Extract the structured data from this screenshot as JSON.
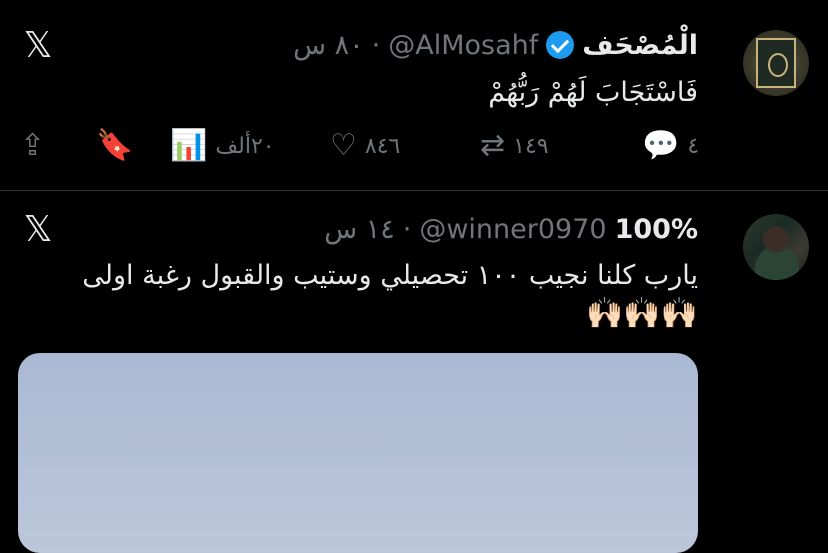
{
  "tweets": [
    {
      "display_name": "الْمُصْحَف",
      "handle": "@AlMosahf",
      "time": "٨٠ س",
      "separator": "·",
      "verified": true,
      "text": "فَاسْتَجَابَ لَهُمْ رَبُّهُمْ",
      "actions": {
        "reply": "٤",
        "retweet": "١٤٩",
        "like": "٨٤٦",
        "views": "٢٠ألف"
      }
    },
    {
      "display_name": "100%",
      "handle": "@winner0970",
      "time": "١٤ س",
      "separator": "·",
      "text": "يارب كلنا نجيب ١٠٠ تحصيلي وستيب والقبول رغبة اولى",
      "emoji": "🙌🏻🙌🏻🙌🏻"
    }
  ],
  "icons": {
    "x_logo": "x-logo",
    "reply": "speech-bubble-icon",
    "retweet": "retweet-icon",
    "like": "heart-icon",
    "views": "bar-chart-icon",
    "bookmark": "bookmark-icon",
    "share": "share-icon"
  },
  "colors": {
    "background": "#000000",
    "text": "#e7e9ea",
    "muted": "#71767b",
    "verified": "#1d9bf0"
  }
}
